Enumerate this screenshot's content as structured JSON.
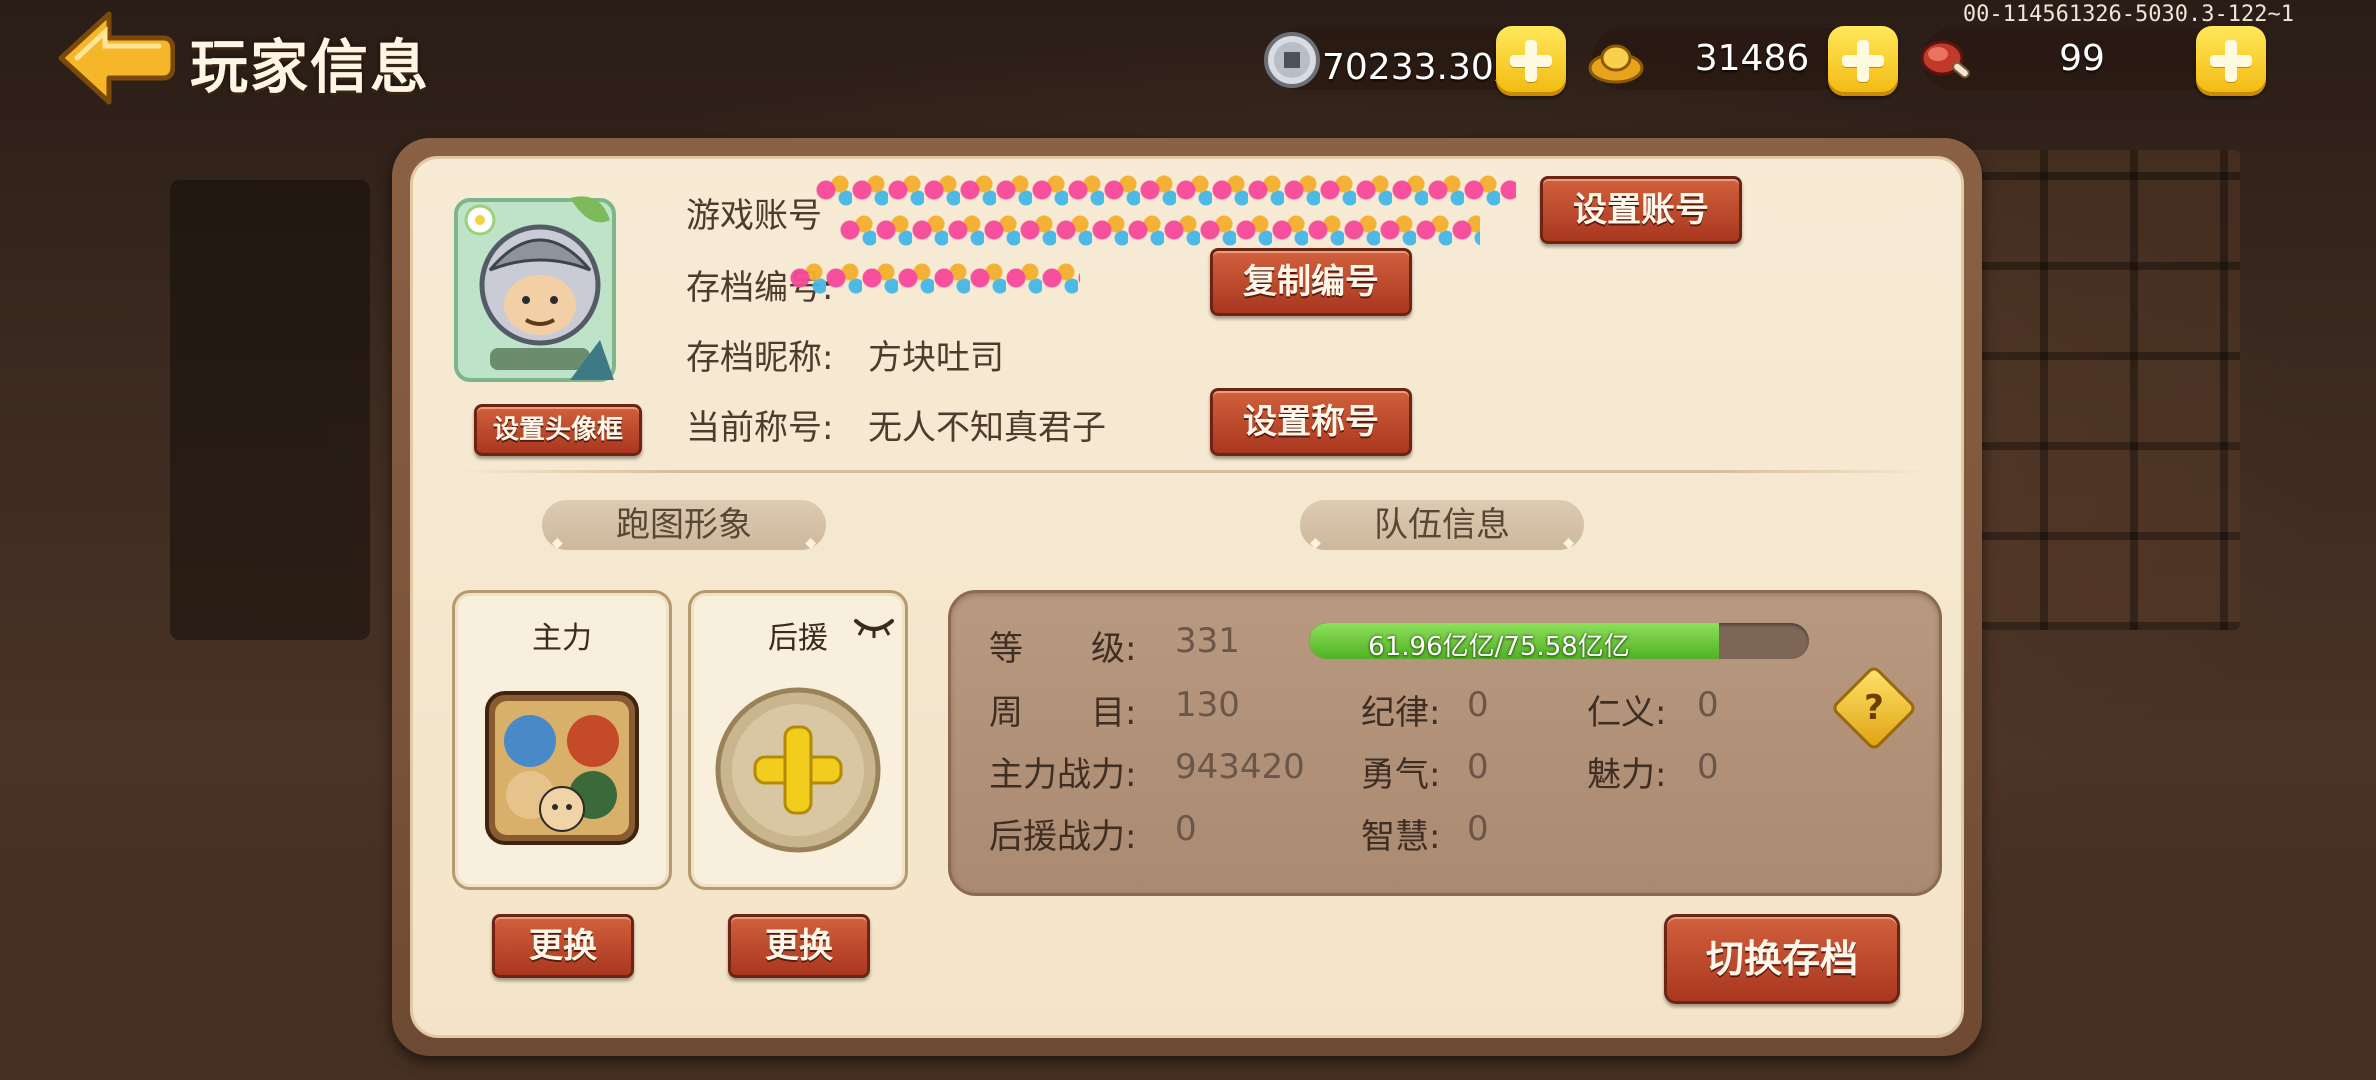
{
  "header": {
    "title": "玩家信息",
    "server_id": "00-114561326-5030.3-122~1"
  },
  "currencies": {
    "silver": "70233.30万",
    "gold": "31486",
    "food": "99"
  },
  "account": {
    "game_account_label": "游戏账号",
    "save_id_label": "存档编号:",
    "save_nickname_label": "存档昵称:",
    "save_nickname": "方块吐司",
    "current_title_label": "当前称号:",
    "current_title": "无人不知真君子",
    "set_account_btn": "设置账号",
    "copy_id_btn": "复制编号",
    "set_title_btn": "设置称号",
    "set_frame_btn": "设置头像框"
  },
  "sections": {
    "map_avatar": "跑图形象",
    "team_info": "队伍信息"
  },
  "slots": {
    "main_label": "主力",
    "support_label": "后援",
    "change_btn": "更换"
  },
  "team": {
    "level_label": "等　　级:",
    "level": "331",
    "exp_text": "61.96亿亿/75.58亿亿",
    "exp_fraction": 0.82,
    "cycle_label": "周　　目:",
    "cycle": "130",
    "main_power_label": "主力战力:",
    "main_power": "943420",
    "support_power_label": "后援战力:",
    "support_power": "0",
    "discipline_label": "纪律:",
    "discipline": "0",
    "courage_label": "勇气:",
    "courage": "0",
    "wisdom_label": "智慧:",
    "wisdom": "0",
    "benevolence_label": "仁义:",
    "benevolence": "0",
    "charm_label": "魅力:",
    "charm": "0",
    "help": "?"
  },
  "switch_save_btn": "切换存档",
  "icons": [
    "back-arrow-icon",
    "silver-coin-icon",
    "gold-ingot-icon",
    "meat-icon",
    "plus-icon",
    "eye-closed-icon",
    "help-icon"
  ]
}
